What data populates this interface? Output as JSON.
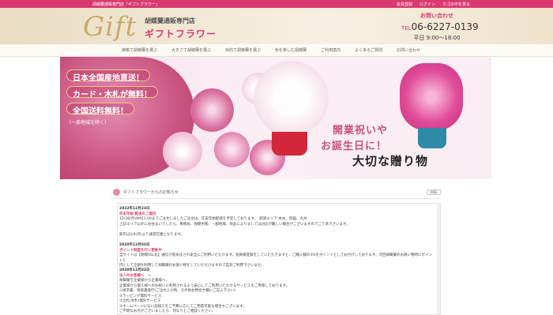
{
  "topbar": {
    "tagline": "胡蝶蘭通販専門店「ギフトフラワー」",
    "links": [
      "会員登録",
      "ログイン",
      "カゴの中を見る"
    ]
  },
  "header": {
    "logo_gift": "Gift",
    "logo_sub": "胡蝶蘭通販専門店",
    "logo_name": "ギフトフラワー",
    "contact_title": "お問い合わせ",
    "contact_tel_prefix": "TEL",
    "contact_tel": "06-6227-0139",
    "contact_hours": "平日 9:00～18:00"
  },
  "nav": [
    "価格で胡蝶蘭を選ぶ",
    "大きさで胡蝶蘭を選ぶ",
    "目的で胡蝶蘭を選ぶ",
    "色を楽しむ胡蝶蘭",
    "ご利用案内",
    "よくあるご質問",
    "お問い合わせ"
  ],
  "hero": {
    "badges": [
      "日本全国産地直送！",
      "カード・木札が無料！",
      "全国送料無料！"
    ],
    "badge_note": "（一部地域を除く）",
    "line1": "開業祝いや",
    "line2": "お誕生日に！",
    "line3": "大切な贈り物"
  },
  "news": {
    "title": "ギフトフラワーからのお知らせ",
    "rss": "RSS",
    "entries": [
      {
        "date": "2022年12月23日",
        "head": "年末年始 配送のご案内",
        "lines": [
          "12/28(月)AM11:00までご注文しましたご注文は、年末年始配達を予定しております。　配達エリア:本州、四国、九州",
          "上記エリア以外にお住まいでしたら、事務局、保健手帳、一部地域、商品によりましては対応が難しい場合がございますのでご了承下さいませ。",
          "",
          "新年は1/4(月)より通常営業となります。"
        ]
      },
      {
        "date": "2020年12月03日",
        "head": "ポイント制度を行い更新中",
        "lines": [
          "当サイトは【期間SSL化】通信が暗号化され安全にご利用いただけます。会員様登録をしていただきますと、ご購入額の3%をポイントとしてお付けしております。次回胡蝶蘭のお買い物時にポイント1",
          "円として全額を利用して胡蝶蘭のお買い物をしていただけますので是非ご利用下さいませ。"
        ]
      },
      {
        "date": "2020年12月03日",
        "head": "法人のお客様へ　→",
        "lines": [
          "胡蝶蘭を企業様から企業様へ、",
          "企業様から個人様へのお祝いに利用されるよう安心してご利用いただけるサービスをご用意しております。",
          "①請求書、領収書発行(ご注文入力時、その他お問合せ欄にご記入下さい)",
          "②ラッピング無料サービス",
          "③立札(木札)無料サービス",
          "③ホームページにない品揃えをご予算に応じてご用意可能な場合もございます。",
          "ご不明なお点がございましたら、何なりとご相談ください。"
        ]
      }
    ]
  },
  "colors": {
    "accent": "#d93a74",
    "gold": "#c7ab6d"
  }
}
